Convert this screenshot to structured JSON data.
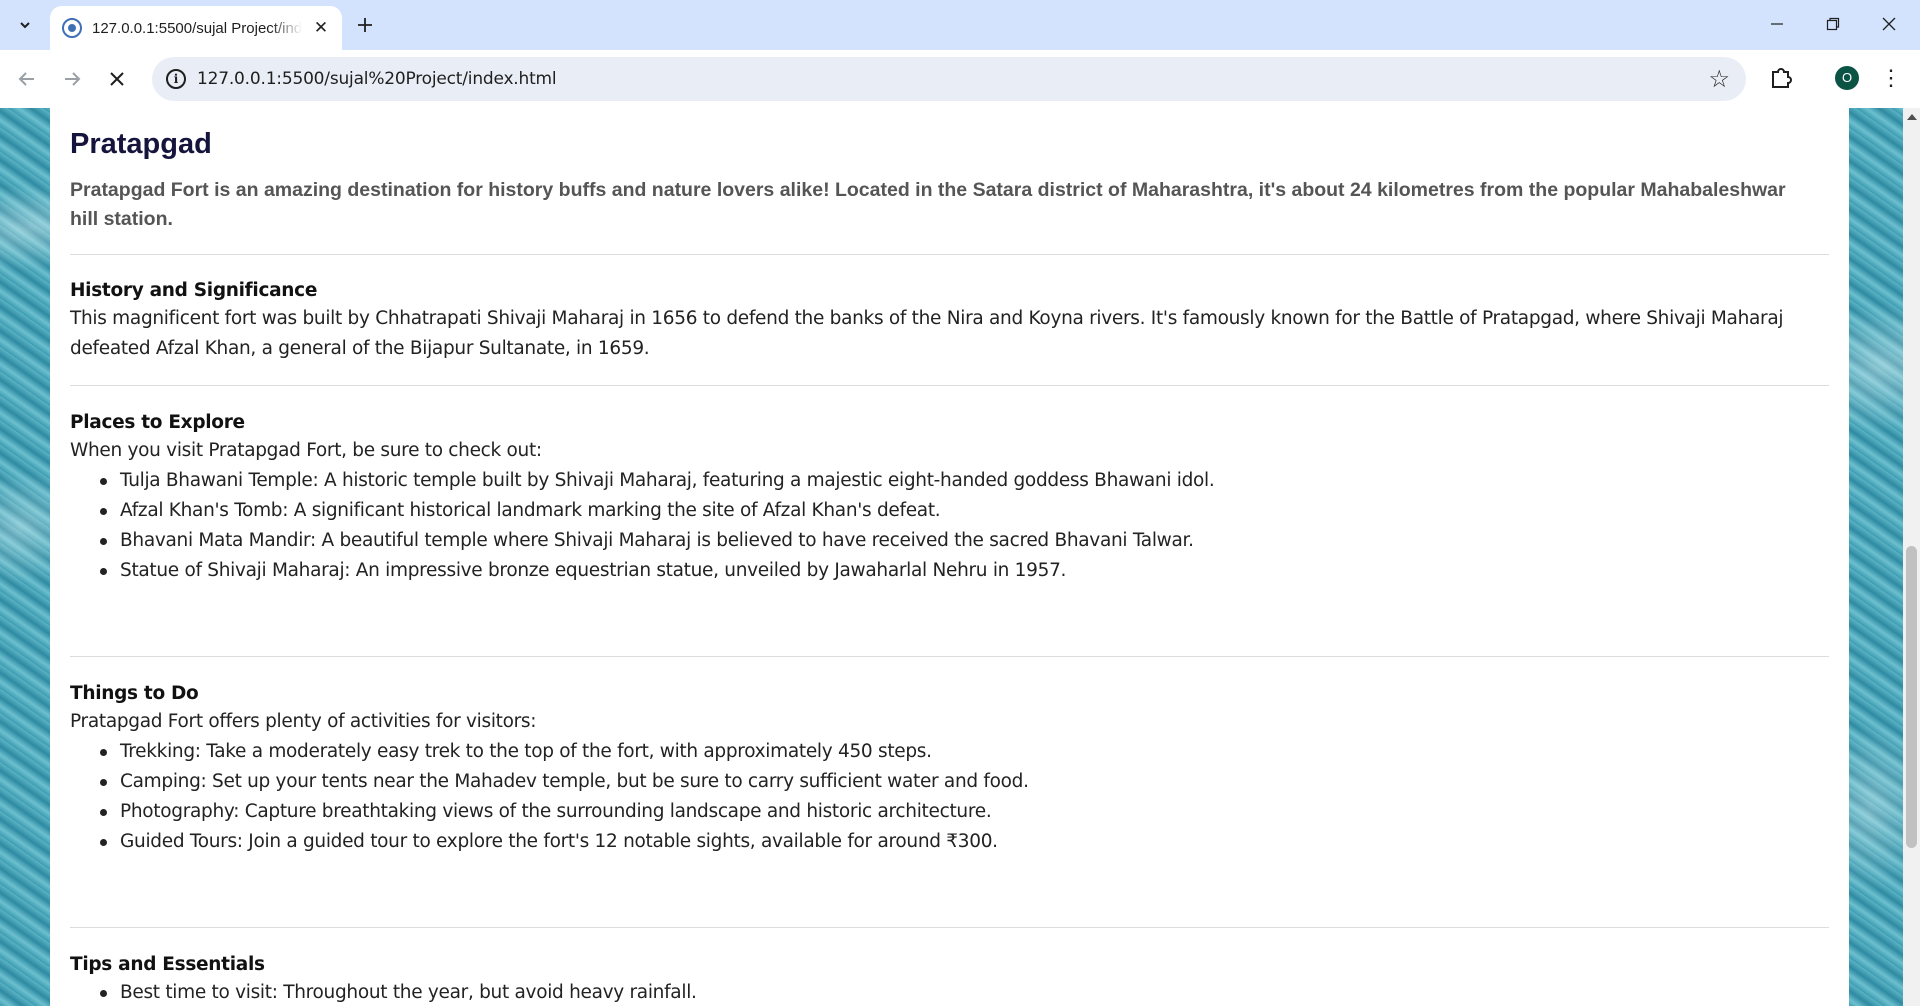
{
  "browser": {
    "tab_title": "127.0.0.1:5500/sujal Project/index.html",
    "url": "127.0.0.1:5500/sujal%20Project/index.html",
    "profile_initial": "O"
  },
  "page": {
    "title": "Pratapgad",
    "intro": "Pratapgad Fort is an amazing destination for history buffs and nature lovers alike! Located in the Satara district of Maharashtra, it's about 24 kilometres from the popular Mahabaleshwar hill station.",
    "history": {
      "heading": "History and Significance",
      "text": "This magnificent fort was built by Chhatrapati Shivaji Maharaj in 1656 to defend the banks of the Nira and Koyna rivers. It's famously known for the Battle of Pratapgad, where Shivaji Maharaj defeated Afzal Khan, a general of the Bijapur Sultanate, in 1659."
    },
    "places": {
      "heading": "Places to Explore",
      "intro": "When you visit Pratapgad Fort, be sure to check out:",
      "items": [
        "Tulja Bhawani Temple: A historic temple built by Shivaji Maharaj, featuring a majestic eight-handed goddess Bhawani idol.",
        "Afzal Khan's Tomb: A significant historical landmark marking the site of Afzal Khan's defeat.",
        "Bhavani Mata Mandir: A beautiful temple where Shivaji Maharaj is believed to have received the sacred Bhavani Talwar.",
        "Statue of Shivaji Maharaj: An impressive bronze equestrian statue, unveiled by Jawaharlal Nehru in 1957."
      ]
    },
    "things": {
      "heading": "Things to Do",
      "intro": "Pratapgad Fort offers plenty of activities for visitors:",
      "items": [
        "Trekking: Take a moderately easy trek to the top of the fort, with approximately 450 steps.",
        "Camping: Set up your tents near the Mahadev temple, but be sure to carry sufficient water and food.",
        "Photography: Capture breathtaking views of the surrounding landscape and historic architecture.",
        "Guided Tours: Join a guided tour to explore the fort's 12 notable sights, available for around ₹300."
      ]
    },
    "tips": {
      "heading": "Tips and Essentials",
      "items": [
        "Best time to visit: Throughout the year, but avoid heavy rainfall."
      ]
    }
  }
}
